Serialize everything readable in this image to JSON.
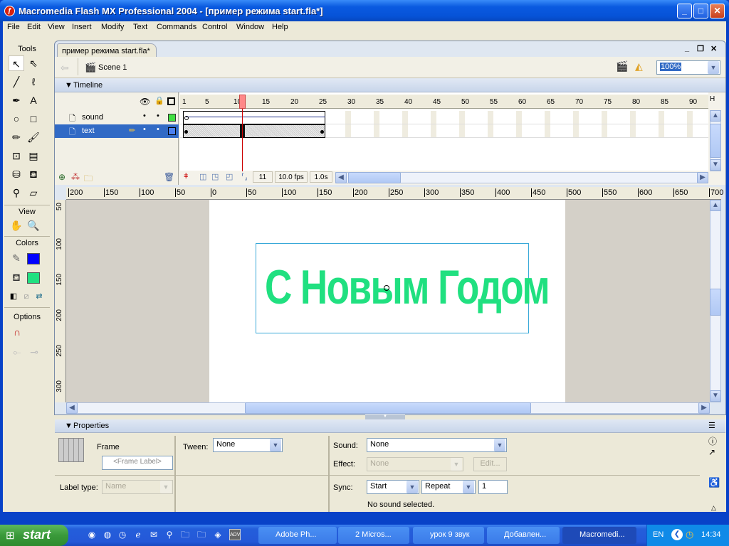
{
  "window": {
    "title": "Macromedia Flash MX Professional 2004 - [пример режима start.fla*]",
    "minimize": "_",
    "maximize": "□",
    "close": "✕"
  },
  "menu": [
    "File",
    "Edit",
    "View",
    "Insert",
    "Modify",
    "Text",
    "Commands",
    "Control",
    "Window",
    "Help"
  ],
  "tools": {
    "header": "Tools",
    "items": [
      {
        "name": "arrow-tool",
        "glyph": "↖"
      },
      {
        "name": "subselect-tool",
        "glyph": "⇖"
      },
      {
        "name": "line-tool",
        "glyph": "╱"
      },
      {
        "name": "lasso-tool",
        "glyph": "ℓ"
      },
      {
        "name": "pen-tool",
        "glyph": "✒"
      },
      {
        "name": "text-tool",
        "glyph": "A"
      },
      {
        "name": "oval-tool",
        "glyph": "○"
      },
      {
        "name": "rectangle-tool",
        "glyph": "□"
      },
      {
        "name": "pencil-tool",
        "glyph": "✏"
      },
      {
        "name": "brush-tool",
        "glyph": "🖌"
      },
      {
        "name": "free-transform-tool",
        "glyph": "⊡"
      },
      {
        "name": "fill-transform-tool",
        "glyph": "▤"
      },
      {
        "name": "ink-bottle-tool",
        "glyph": "⛁"
      },
      {
        "name": "paint-bucket-tool",
        "glyph": "⛾"
      },
      {
        "name": "eyedropper-tool",
        "glyph": "⚲"
      },
      {
        "name": "eraser-tool",
        "glyph": "▱"
      }
    ],
    "view_header": "View",
    "colors_header": "Colors",
    "options_header": "Options",
    "stroke_color": "#0000ff",
    "fill_color": "#20e080"
  },
  "document": {
    "tab": "пример режима start.fla*",
    "scene": "Scene 1",
    "zoom": "100%",
    "doc_min": "_",
    "doc_restore": "❐",
    "doc_close": "✕"
  },
  "timeline": {
    "header": "Timeline",
    "layers": [
      {
        "name": "sound",
        "selected": false,
        "outline_color": "#40e040"
      },
      {
        "name": "text",
        "selected": true,
        "outline_color": "#4a80f0"
      }
    ],
    "frame_numbers": [
      "1",
      "5",
      "10",
      "15",
      "20",
      "25",
      "30",
      "35",
      "40",
      "45",
      "50",
      "55",
      "60",
      "65",
      "70",
      "75",
      "80",
      "85",
      "90"
    ],
    "current_frame": "11",
    "fps": "10.0 fps",
    "time": "1.0s"
  },
  "rulers": {
    "horizontal": [
      "200",
      "150",
      "100",
      "50",
      "0",
      "50",
      "100",
      "150",
      "200",
      "250",
      "300",
      "350",
      "400",
      "450",
      "500",
      "550",
      "600",
      "650",
      "700"
    ],
    "vertical": [
      "50",
      "100",
      "150",
      "200",
      "250",
      "300"
    ]
  },
  "stage": {
    "text": "С Новым Годом",
    "text_color": "#20e080"
  },
  "properties": {
    "header": "Properties",
    "frame_label": "Frame",
    "frame_label_placeholder": "<Frame Label>",
    "label_type_label": "Label type:",
    "label_type_value": "Name",
    "tween_label": "Tween:",
    "tween_value": "None",
    "sound_label": "Sound:",
    "sound_value": "None",
    "effect_label": "Effect:",
    "effect_value": "None",
    "edit_button": "Edit...",
    "sync_label": "Sync:",
    "sync_value": "Start",
    "repeat_value": "Repeat",
    "repeat_count": "1",
    "status": "No sound selected."
  },
  "taskbar": {
    "start": "start",
    "tasks": [
      {
        "label": "Adobe Ph...",
        "active": false
      },
      {
        "label": "2 Micros...",
        "active": false
      },
      {
        "label": "урок 9 звук",
        "active": false
      },
      {
        "label": "Добавлен...",
        "active": false
      },
      {
        "label": "Macromedi...",
        "active": true
      }
    ],
    "lang": "EN",
    "clock": "14:34"
  }
}
